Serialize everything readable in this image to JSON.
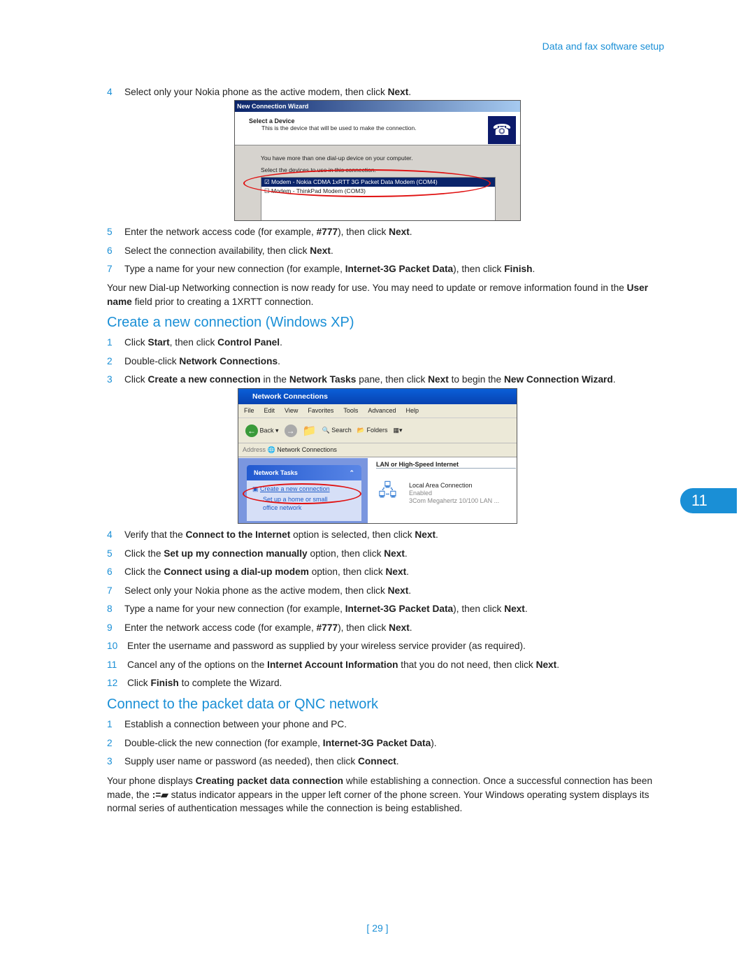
{
  "header": "Data and fax software setup",
  "section1_steps": [
    {
      "n": "4",
      "segs": [
        [
          "Select only your Nokia phone as the active modem, then click ",
          0
        ],
        [
          "Next",
          1
        ],
        [
          ".",
          0
        ]
      ]
    }
  ],
  "wizard": {
    "title": "New Connection Wizard",
    "heading": "Select a Device",
    "subheading": "This is the device that will be used to make the connection.",
    "line1": "You have more than one dial-up device on your computer.",
    "line2": "Select the devices to use in this connection.",
    "devices": [
      {
        "label": "Modem - Nokia CDMA 1xRTT 3G Packet Data Modem (COM4)",
        "checked": true
      },
      {
        "label": "Modem - ThinkPad Modem (COM3)",
        "checked": false
      }
    ]
  },
  "section1_steps_b": [
    {
      "n": "5",
      "segs": [
        [
          "Enter the network access code (for example, ",
          0
        ],
        [
          "#777",
          1
        ],
        [
          "), then click ",
          0
        ],
        [
          "Next",
          1
        ],
        [
          ".",
          0
        ]
      ]
    },
    {
      "n": "6",
      "segs": [
        [
          "Select the connection availability, then click ",
          0
        ],
        [
          "Next",
          1
        ],
        [
          ".",
          0
        ]
      ]
    },
    {
      "n": "7",
      "segs": [
        [
          "Type a name for your new connection (for example, ",
          0
        ],
        [
          "Internet-3G Packet Data",
          1
        ],
        [
          "), then click ",
          0
        ],
        [
          "Finish",
          1
        ],
        [
          ".",
          0
        ]
      ]
    }
  ],
  "para1": [
    [
      "Your new Dial-up Networking connection is now ready for use. You may need to update or remove information found in the ",
      0
    ],
    [
      "User name",
      1
    ],
    [
      " field prior to creating a 1XRTT connection.",
      0
    ]
  ],
  "heading2": "Create a new connection (Windows XP)",
  "section2_steps": [
    {
      "n": "1",
      "segs": [
        [
          "Click ",
          0
        ],
        [
          "Start",
          1
        ],
        [
          ", then click ",
          0
        ],
        [
          "Control Panel",
          1
        ],
        [
          ".",
          0
        ]
      ]
    },
    {
      "n": "2",
      "segs": [
        [
          "Double-click ",
          0
        ],
        [
          "Network Connections",
          1
        ],
        [
          ".",
          0
        ]
      ]
    },
    {
      "n": "3",
      "segs": [
        [
          "Click ",
          0
        ],
        [
          "Create a new connection",
          1
        ],
        [
          " in the ",
          0
        ],
        [
          "Network Tasks",
          1
        ],
        [
          " pane, then click ",
          0
        ],
        [
          "Next",
          1
        ],
        [
          " to begin the ",
          0
        ],
        [
          "New Connection Wizard",
          1
        ],
        [
          ".",
          0
        ]
      ]
    }
  ],
  "netconn": {
    "title": "Network Connections",
    "menu": [
      "File",
      "Edit",
      "View",
      "Favorites",
      "Tools",
      "Advanced",
      "Help"
    ],
    "back": "Back",
    "search": "Search",
    "folders": "Folders",
    "address_label": "Address",
    "address": "Network Connections",
    "tasks_title": "Network Tasks",
    "task1": "Create a new connection",
    "task2": "Set up a home or small office network",
    "group": "LAN or High-Speed Internet",
    "conn_name": "Local Area Connection",
    "conn_status": "Enabled",
    "conn_device": "3Com Megahertz 10/100 LAN ..."
  },
  "section2_steps_b": [
    {
      "n": "4",
      "segs": [
        [
          "Verify that the ",
          0
        ],
        [
          "Connect to the Internet",
          1
        ],
        [
          " option is selected, then click ",
          0
        ],
        [
          "Next",
          1
        ],
        [
          ".",
          0
        ]
      ]
    },
    {
      "n": "5",
      "segs": [
        [
          "Click the ",
          0
        ],
        [
          "Set up my connection manually",
          1
        ],
        [
          " option, then click ",
          0
        ],
        [
          "Next",
          1
        ],
        [
          ".",
          0
        ]
      ]
    },
    {
      "n": "6",
      "segs": [
        [
          "Click the ",
          0
        ],
        [
          "Connect using a dial-up modem",
          1
        ],
        [
          " option, then click ",
          0
        ],
        [
          "Next",
          1
        ],
        [
          ".",
          0
        ]
      ]
    },
    {
      "n": "7",
      "segs": [
        [
          "Select only your Nokia phone as the active modem, then click ",
          0
        ],
        [
          "Next",
          1
        ],
        [
          ".",
          0
        ]
      ]
    },
    {
      "n": "8",
      "segs": [
        [
          "Type a name for your new connection (for example, ",
          0
        ],
        [
          "Internet-3G Packet Data",
          1
        ],
        [
          "), then click ",
          0
        ],
        [
          "Next",
          1
        ],
        [
          ".",
          0
        ]
      ]
    },
    {
      "n": "9",
      "segs": [
        [
          "Enter the network access code (for example, ",
          0
        ],
        [
          "#777",
          1
        ],
        [
          "), then click ",
          0
        ],
        [
          "Next",
          1
        ],
        [
          ".",
          0
        ]
      ]
    },
    {
      "n": "10",
      "segs": [
        [
          "Enter the username and password as supplied by your wireless service provider (as required).",
          0
        ]
      ]
    },
    {
      "n": "11",
      "segs": [
        [
          "Cancel any of the options on the ",
          0
        ],
        [
          "Internet Account Information",
          1
        ],
        [
          " that you do not need, then click ",
          0
        ],
        [
          "Next",
          1
        ],
        [
          ".",
          0
        ]
      ]
    },
    {
      "n": "12",
      "segs": [
        [
          "Click ",
          0
        ],
        [
          "Finish",
          1
        ],
        [
          " to complete the Wizard.",
          0
        ]
      ]
    }
  ],
  "heading3": "Connect to the packet data or QNC network",
  "section3_steps": [
    {
      "n": "1",
      "segs": [
        [
          "Establish a connection between your phone and PC.",
          0
        ]
      ]
    },
    {
      "n": "2",
      "segs": [
        [
          "Double-click the new connection (for example, ",
          0
        ],
        [
          "Internet-3G Packet Data",
          1
        ],
        [
          ").",
          0
        ]
      ]
    },
    {
      "n": "3",
      "segs": [
        [
          "Supply user name or password (as needed), then click ",
          0
        ],
        [
          "Connect",
          1
        ],
        [
          ".",
          0
        ]
      ]
    }
  ],
  "para2": [
    [
      "Your phone displays ",
      0
    ],
    [
      "Creating packet data connection",
      1
    ],
    [
      " while establishing a connection. Once a successful connection has been made, the ",
      0
    ],
    [
      "@icon",
      0
    ],
    [
      " status indicator appears in the upper left corner of the phone screen. Your Windows operating system displays its normal series of authentication messages while the connection is being established.",
      0
    ]
  ],
  "chapter_tab": "11",
  "page_number": "[ 29 ]"
}
